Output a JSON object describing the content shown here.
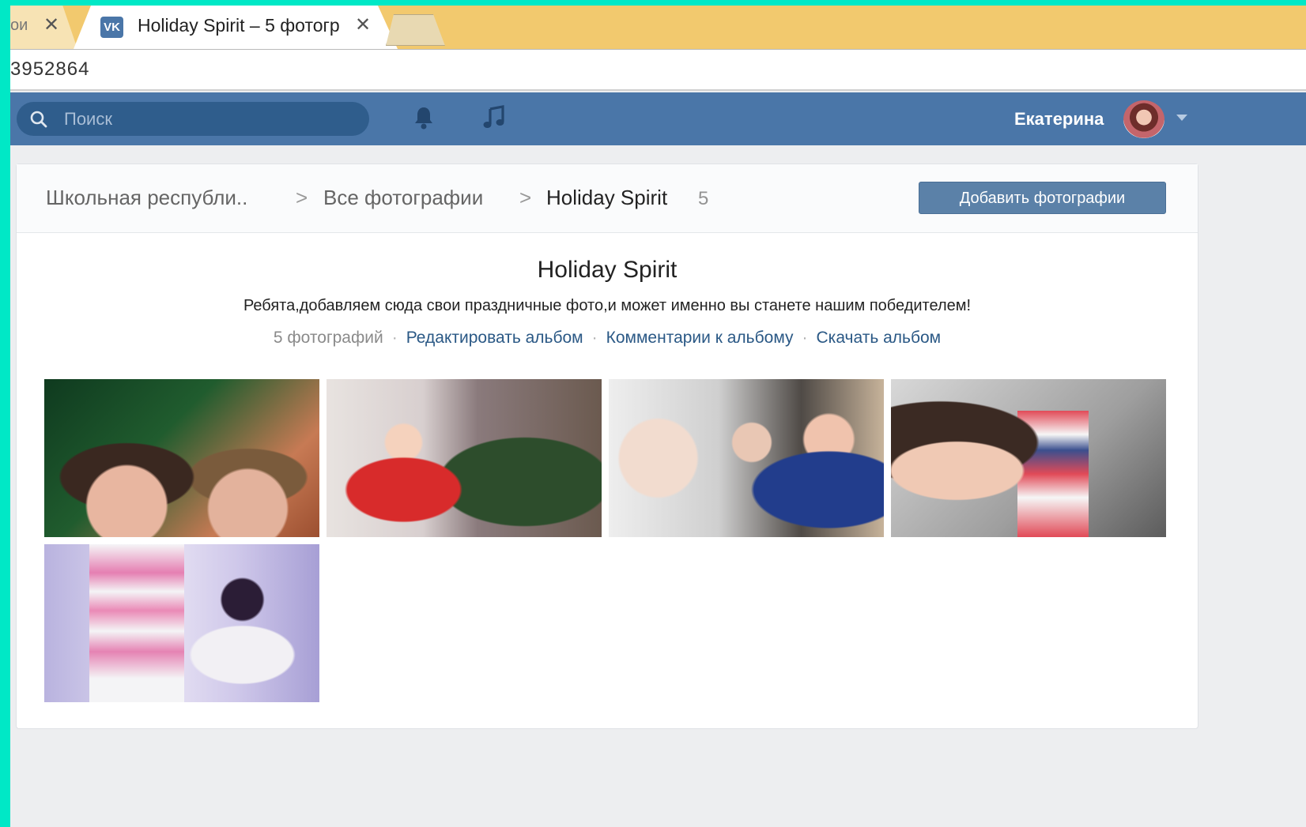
{
  "browser": {
    "tabs": [
      {
        "title": "ои",
        "close": "✕"
      },
      {
        "title": "Holiday Spirit – 5 фотогр",
        "close": "✕",
        "favicon": "VK"
      }
    ],
    "address": "3952864"
  },
  "header": {
    "search_placeholder": "Поиск",
    "user_name": "Екатерина",
    "brand_color": "#4a76a8"
  },
  "breadcrumbs": {
    "items": [
      "Школьная республи..",
      "Все фотографии",
      "Holiday Spirit"
    ],
    "separator": ">",
    "count": "5"
  },
  "album": {
    "add_button": "Добавить фотографии",
    "title": "Holiday Spirit",
    "description": "Ребята,добавляем сюда свои праздничные фото,и может именно вы станете нашим победителем!",
    "photo_count": "5 фотографий",
    "edit_link": "Редактировать альбом",
    "comments_link": "Комментарии к альбому",
    "download_link": "Скачать альбом",
    "dot": "·"
  },
  "photos": [
    "photo-1",
    "photo-2",
    "photo-3",
    "photo-4",
    "photo-5"
  ],
  "icons": [
    "search-icon",
    "bell-icon",
    "music-icon",
    "close-icon",
    "chevron-down-icon"
  ]
}
